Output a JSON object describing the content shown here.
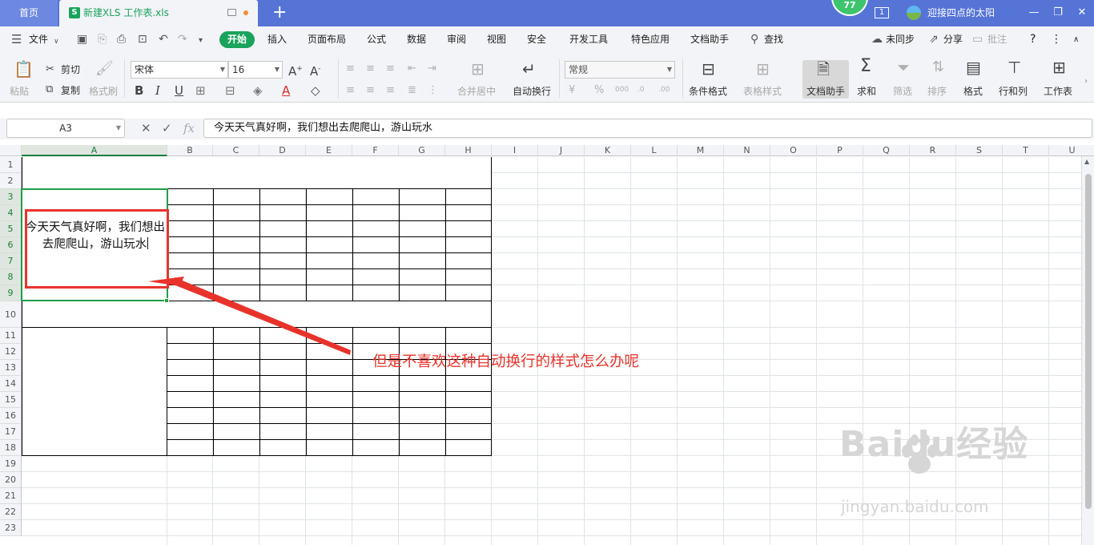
{
  "titlebar": {
    "home_tab": "首页",
    "doc_tab": "新建XLS 工作表.xls",
    "xls_icon": "S",
    "new_tab": "+",
    "level_badge": "77",
    "window_num": "1",
    "username": "迎接四点的太阳",
    "win_min": "—",
    "win_restore": "❐",
    "win_close": "✕"
  },
  "menubar": {
    "file": "文件",
    "start": "开始",
    "items": [
      "插入",
      "页面布局",
      "公式",
      "数据",
      "审阅",
      "视图",
      "安全",
      "开发工具",
      "特色应用",
      "文档助手"
    ],
    "search": "查找",
    "sync": "未同步",
    "share": "分享",
    "comment": "批注",
    "help": "?"
  },
  "ribbon": {
    "paste": "粘贴",
    "cut": "剪切",
    "copy": "复制",
    "format_painter": "格式刷",
    "font_name": "宋体",
    "font_size": "16",
    "bold": "B",
    "italic": "I",
    "underline": "U",
    "merge": "合并居中",
    "wrap": "自动换行",
    "number_format": "常规",
    "cond_format": "条件格式",
    "table_style": "表格样式",
    "doc_assistant": "文档助手",
    "sum": "求和",
    "filter": "筛选",
    "sort": "排序",
    "format": "格式",
    "rowcol": "行和列",
    "worksheet": "工作表"
  },
  "formula_bar": {
    "name_box": "A3",
    "cancel": "✕",
    "confirm": "✓",
    "fx": "fx",
    "content": "今天天气真好啊，我们想出去爬爬山，游山玩水"
  },
  "sheet": {
    "columns": [
      "A",
      "B",
      "C",
      "D",
      "E",
      "F",
      "G",
      "H",
      "I",
      "J",
      "K",
      "L",
      "M",
      "N",
      "O",
      "P",
      "Q",
      "R",
      "S",
      "T",
      "U"
    ],
    "rows": [
      "1",
      "2",
      "3",
      "4",
      "5",
      "6",
      "7",
      "8",
      "9",
      "10",
      "11",
      "12",
      "13",
      "14",
      "15",
      "16",
      "17",
      "18",
      "19",
      "20",
      "21",
      "22",
      "23"
    ],
    "active_cell": "A3",
    "cell_a3_text": "今天天气真好啊，我们想出去爬爬山，游山玩水"
  },
  "annotation": "但是不喜欢这种自动换行的样式怎么办呢",
  "watermark": {
    "logo": "Baidu经验",
    "url": "jingyan.baidu.com"
  },
  "colors": {
    "accent": "#1aa35c",
    "titlebar": "#5574d6",
    "annotation": "#e8332b",
    "selection": "#1f9e48"
  }
}
